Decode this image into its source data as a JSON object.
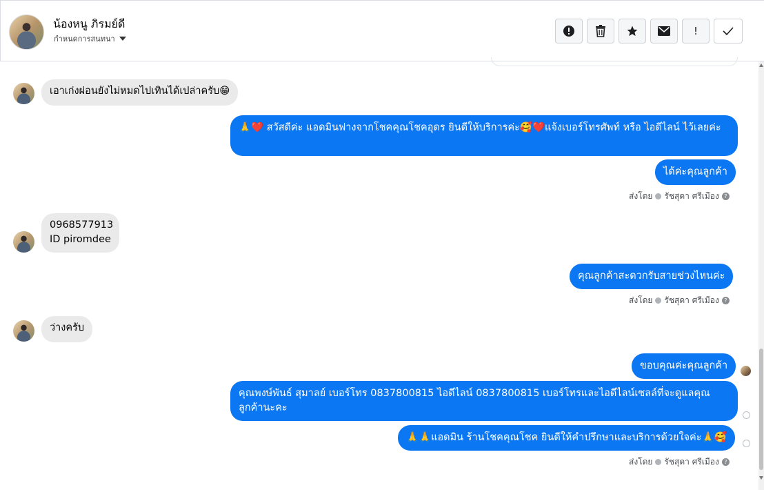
{
  "header": {
    "name": "น้องหนู ภิรมย์ดี",
    "subtitle": "กำหนดการสนทนา",
    "actions": [
      {
        "icon": "alert-circle-icon",
        "glyph": "!"
      },
      {
        "icon": "trash-icon",
        "glyph": "🗑"
      },
      {
        "icon": "star-icon",
        "glyph": "★"
      },
      {
        "icon": "envelope-icon",
        "glyph": "✉"
      },
      {
        "icon": "exclamation-icon",
        "glyph": "!"
      },
      {
        "icon": "check-icon",
        "glyph": "✓"
      }
    ]
  },
  "messages": {
    "m1": "เอาเก่งผ่อนยังไม่หมดไปเทินได้เปล่าครับ😁",
    "m2": "🙏❤️ สวัสดีค่ะ แอดมินฟางจากโชคคุณโชคอุดร ยินดีให้บริการค่ะ🥰❤️แจ้งเบอร์โทรศัพท์ หรือ ไอดีไลน์  ไว้เลยค่ะ",
    "m3": "ได้ค่ะคุณลูกค้า",
    "m4": "0968577913\nID piromdee",
    "m5": "คุณลูกค้าสะดวกรับสายช่วงไหนค่ะ",
    "m6": "ว่างครับ",
    "m7": "ขอบคุณค่ะคุณลูกค้า",
    "m8": "คุณพงษ์พันธ์ สุมาลย์      เบอร์โทร 0837800815  ไอดีไลน์ 0837800815  เบอร์โทรและไอดีไลน์เซลล์ที่จะดูแลคุณลูกค้านะคะ",
    "m9": "🙏🙏แอดมิน ร้านโชคคุณโชค ยินดีให้คำปรึกษาและบริการด้วยใจค่ะ🙏🥰"
  },
  "sent_by": {
    "prefix": "ส่งโดย",
    "agent": "รัชสุดา ศรีเมือง",
    "help": "?"
  }
}
